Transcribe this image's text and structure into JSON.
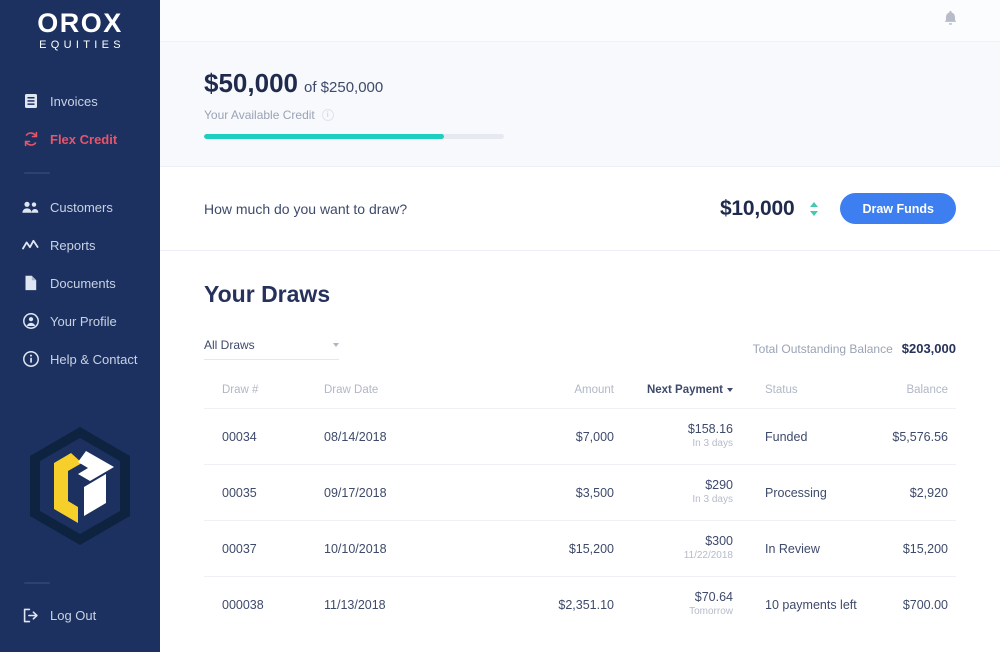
{
  "sidebar": {
    "logo": {
      "word": "OROX",
      "sub": "EQUITIES"
    },
    "items": [
      {
        "label": "Invoices",
        "icon": "invoice-icon",
        "active": false
      },
      {
        "label": "Flex Credit",
        "icon": "refresh-icon",
        "active": true
      },
      {
        "label": "Customers",
        "icon": "users-icon",
        "active": false
      },
      {
        "label": "Reports",
        "icon": "chart-line-icon",
        "active": false
      },
      {
        "label": "Documents",
        "icon": "document-icon",
        "active": false
      },
      {
        "label": "Your Profile",
        "icon": "user-circle-icon",
        "active": false
      },
      {
        "label": "Help & Contact",
        "icon": "info-circle-icon",
        "active": false
      }
    ],
    "logout": {
      "label": "Log Out",
      "icon": "logout-icon"
    },
    "colors": {
      "background": "#1c3160",
      "active": "#e8546a",
      "text": "#c8d2e4"
    }
  },
  "topbar": {
    "notification_icon": "bell-icon"
  },
  "credit": {
    "available": "$50,000",
    "of_total": "of $250,000",
    "label": "Your Available Credit",
    "info_icon": "i",
    "progress_percent": 80,
    "bar_color": "#1ecfc0"
  },
  "draw": {
    "question": "How much do you want to draw?",
    "amount": "$10,000",
    "button_label": "Draw Funds",
    "button_color": "#3d7ef0"
  },
  "draws": {
    "title": "Your Draws",
    "filter_selected": "All Draws",
    "total_label": "Total Outstanding Balance",
    "total_value": "$203,000",
    "columns": [
      {
        "label": "Draw #",
        "sorted": false
      },
      {
        "label": "Draw Date",
        "sorted": false
      },
      {
        "label": "Amount",
        "sorted": false
      },
      {
        "label": "Next Payment",
        "sorted": true
      },
      {
        "label": "Status",
        "sorted": false
      },
      {
        "label": "Balance",
        "sorted": false
      }
    ],
    "rows": [
      {
        "number": "00034",
        "date": "08/14/2018",
        "amount": "$7,000",
        "next_payment": "$158.16",
        "next_payment_when": "In 3 days",
        "status": "Funded",
        "balance": "$5,576.56"
      },
      {
        "number": "00035",
        "date": "09/17/2018",
        "amount": "$3,500",
        "next_payment": "$290",
        "next_payment_when": "In 3 days",
        "status": "Processing",
        "balance": "$2,920"
      },
      {
        "number": "00037",
        "date": "10/10/2018",
        "amount": "$15,200",
        "next_payment": "$300",
        "next_payment_when": "11/22/2018",
        "status": "In Review",
        "balance": "$15,200"
      },
      {
        "number": "000038",
        "date": "11/13/2018",
        "amount": "$2,351.10",
        "next_payment": "$70.64",
        "next_payment_when": "Tomorrow",
        "status": "10 payments left",
        "balance": "$700.00"
      }
    ]
  }
}
